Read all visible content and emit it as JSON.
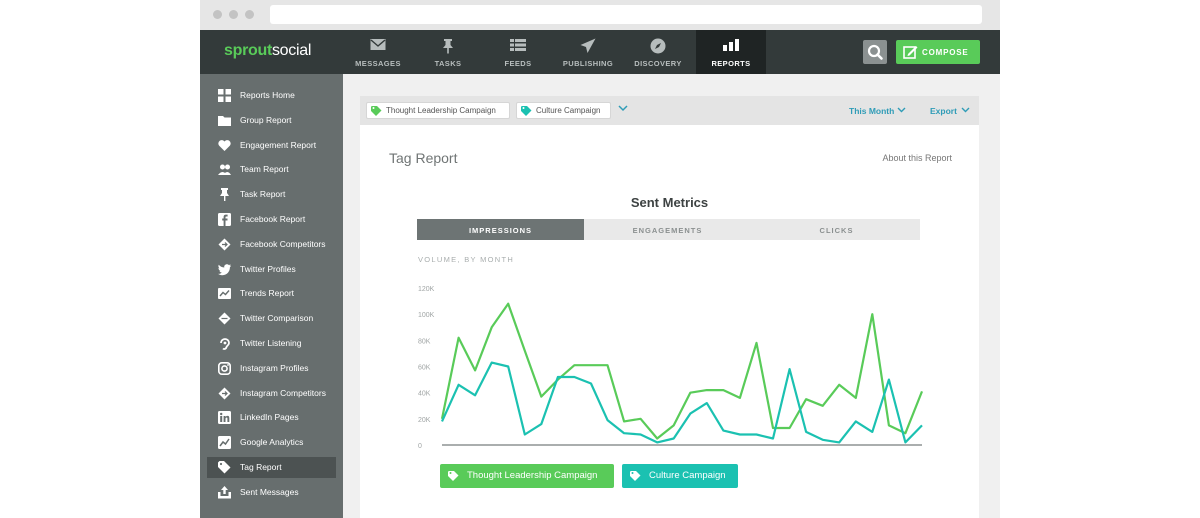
{
  "brand": {
    "name_part1": "sprout",
    "name_part2": "social"
  },
  "nav": [
    {
      "label": "MESSAGES",
      "icon": "envelope-icon"
    },
    {
      "label": "TASKS",
      "icon": "pin-icon"
    },
    {
      "label": "FEEDS",
      "icon": "list-icon"
    },
    {
      "label": "PUBLISHING",
      "icon": "paper-plane-icon"
    },
    {
      "label": "DISCOVERY",
      "icon": "compass-icon"
    },
    {
      "label": "REPORTS",
      "icon": "bar-chart-icon",
      "active": true
    }
  ],
  "toolbar": {
    "compose_label": "COMPOSE"
  },
  "sidebar": {
    "items": [
      {
        "label": "Reports Home",
        "icon": "grid-icon"
      },
      {
        "label": "Group Report",
        "icon": "folder-icon"
      },
      {
        "label": "Engagement Report",
        "icon": "heart-icon"
      },
      {
        "label": "Team Report",
        "icon": "team-icon"
      },
      {
        "label": "Task Report",
        "icon": "pin-icon"
      },
      {
        "label": "Facebook Report",
        "icon": "facebook-icon"
      },
      {
        "label": "Facebook Competitors",
        "icon": "competitors-icon"
      },
      {
        "label": "Twitter Profiles",
        "icon": "twitter-icon"
      },
      {
        "label": "Trends Report",
        "icon": "trends-icon"
      },
      {
        "label": "Twitter Comparison",
        "icon": "comparison-icon"
      },
      {
        "label": "Twitter Listening",
        "icon": "listening-icon"
      },
      {
        "label": "Instagram Profiles",
        "icon": "instagram-icon"
      },
      {
        "label": "Instagram Competitors",
        "icon": "competitors-icon"
      },
      {
        "label": "LinkedIn Pages",
        "icon": "linkedin-icon"
      },
      {
        "label": "Google Analytics",
        "icon": "analytics-icon"
      },
      {
        "label": "Tag Report",
        "icon": "tag-icon",
        "active": true
      },
      {
        "label": "Sent Messages",
        "icon": "sent-icon"
      }
    ]
  },
  "filters": {
    "tags": [
      {
        "label": "Thought Leadership Campaign",
        "color": "#59cb59"
      },
      {
        "label": "Culture Campaign",
        "color": "#1bc1b1"
      }
    ],
    "range_label": "This Month",
    "export_label": "Export"
  },
  "report": {
    "title": "Tag Report",
    "about_label": "About this Report",
    "chart_title": "Sent Metrics",
    "tabs": [
      {
        "label": "IMPRESSIONS",
        "active": true
      },
      {
        "label": "ENGAGEMENTS"
      },
      {
        "label": "CLICKS"
      }
    ],
    "subtitle": "VOLUME, BY MONTH"
  },
  "colors": {
    "green": "#59cb59",
    "teal": "#1bc1b1",
    "topbar": "#333a3a",
    "sidebar": "#676e6e"
  },
  "chart_data": {
    "type": "line",
    "x": [
      1,
      2,
      3,
      4,
      5,
      6,
      7,
      8,
      9,
      10,
      11,
      12,
      13,
      14,
      15,
      16,
      17,
      18,
      19,
      20,
      21,
      22,
      23,
      24,
      25,
      26,
      27,
      28,
      29,
      30,
      31,
      32,
      33,
      34
    ],
    "yticks": [
      "0",
      "20K",
      "40K",
      "60K",
      "80K",
      "100K",
      "120K"
    ],
    "ylim": [
      0,
      120000
    ],
    "grid": false,
    "series": [
      {
        "name": "Thought Leadership Campaign",
        "color": "#59cb59",
        "values": [
          20000,
          82000,
          57000,
          90000,
          108000,
          72000,
          37000,
          50000,
          61000,
          61000,
          61000,
          18000,
          20000,
          5000,
          15000,
          40000,
          42000,
          42000,
          36000,
          78000,
          13000,
          13000,
          35000,
          30000,
          46000,
          36000,
          100000,
          15000,
          9000,
          41000
        ]
      },
      {
        "name": "Culture Campaign",
        "color": "#1bc1b1",
        "values": [
          18000,
          46000,
          38000,
          63000,
          60000,
          8000,
          16000,
          52000,
          52000,
          47000,
          19000,
          9000,
          8000,
          2000,
          5000,
          24000,
          32000,
          11000,
          8000,
          8000,
          5000,
          58000,
          10000,
          4000,
          2000,
          18000,
          10000,
          50000,
          2000,
          15000
        ]
      }
    ]
  }
}
